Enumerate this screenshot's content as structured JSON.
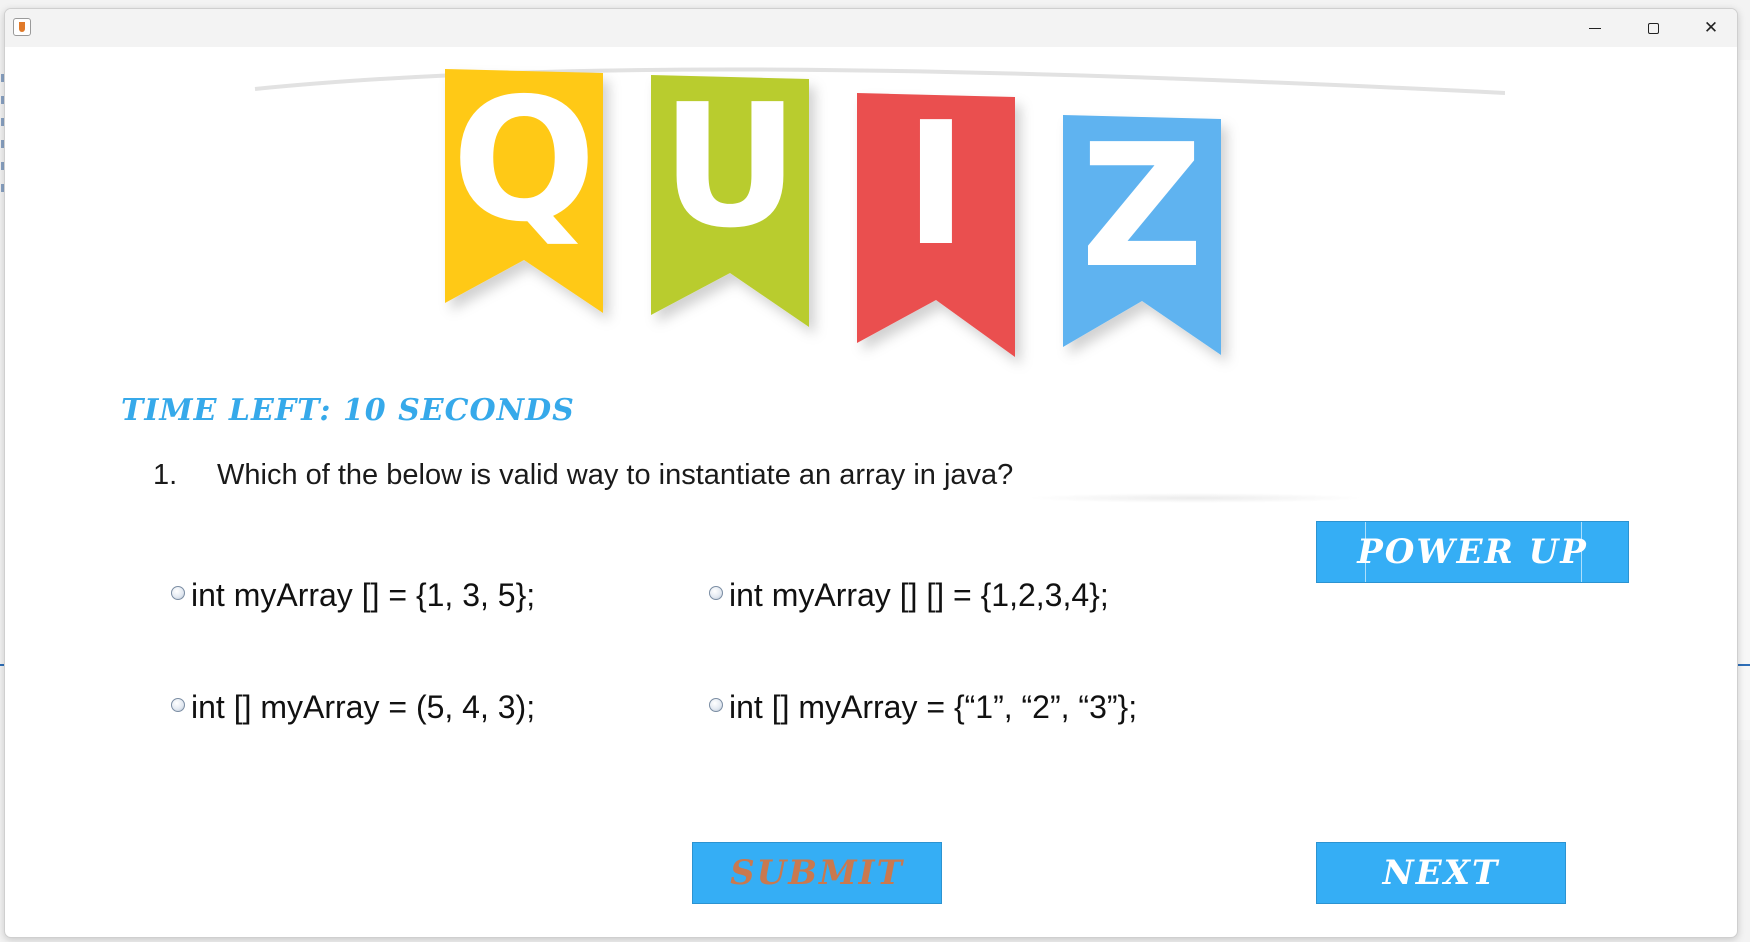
{
  "window": {
    "minimize_icon": "minimize-icon",
    "maximize_icon": "maximize-icon",
    "close_icon": "close-icon",
    "close_glyph": "✕"
  },
  "banner": {
    "letters": [
      "Q",
      "U",
      "I",
      "Z"
    ],
    "colors": [
      "#ffc917",
      "#b9cc2e",
      "#ea4f4f",
      "#5eb3f0"
    ]
  },
  "timer": {
    "text": "TIME LEFT: 10 SECONDS"
  },
  "question": {
    "number": "1.",
    "text": "Which of the below is valid way to instantiate an array in java?"
  },
  "options": [
    {
      "label": "int myArray [] = {1, 3, 5};"
    },
    {
      "label": "int myArray [] [] = {1,2,3,4};"
    },
    {
      "label": "int [] myArray = (5, 4, 3);"
    },
    {
      "label": "int [] myArray = {“1”, “2”, “3”};"
    }
  ],
  "buttons": {
    "power_up": "POWER UP",
    "submit": "SUBMIT",
    "next": "NEXT"
  },
  "colors": {
    "accent": "#35aef5",
    "timer": "#36a9ea",
    "submit_text_disabled": "#c9794f"
  }
}
